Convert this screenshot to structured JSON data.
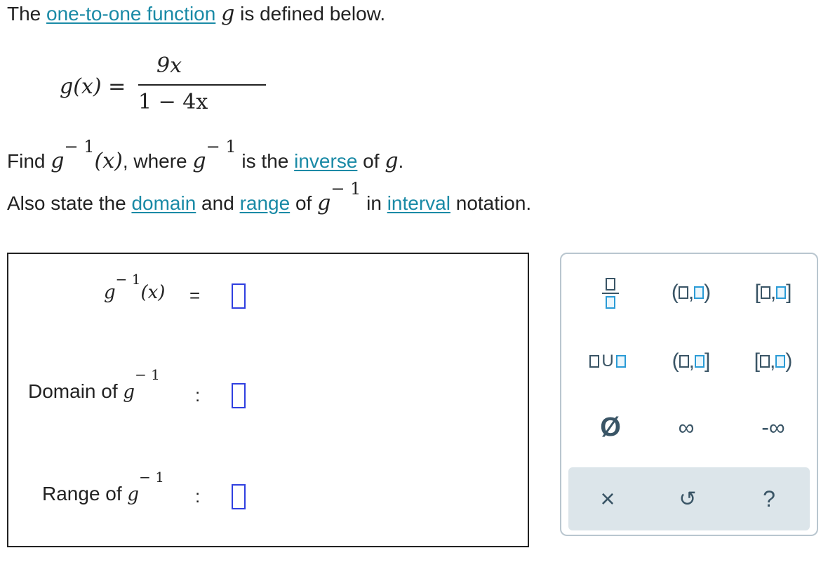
{
  "problem": {
    "line1": {
      "prefix": "The ",
      "link": "one-to-one function",
      "var": "g",
      "suffix": " is defined below."
    },
    "formula": {
      "lhs": "g(x) =",
      "numerator": "9x",
      "denominator": "1 − 4x"
    },
    "line2": {
      "find": "Find ",
      "g": "g",
      "sup": "− 1",
      "arg": "(x)",
      "where": ", where ",
      "is_the": " is the ",
      "link": "inverse",
      "of": " of ",
      "end": "."
    },
    "line3": {
      "prefix": "Also state the ",
      "domain_link": "domain",
      "and": " and ",
      "range_link": "range",
      "of": " of ",
      "g": "g",
      "sup": "− 1",
      "in": " in ",
      "interval_link": "interval",
      "suffix": " notation."
    }
  },
  "answer": {
    "inverse_label_g": "g",
    "inverse_label_sup": "− 1",
    "inverse_label_arg": "(x)",
    "equals": "=",
    "domain_label": "Domain of ",
    "range_label": "Range of ",
    "g": "g",
    "sup": "− 1",
    "colon": ":"
  },
  "keypad": {
    "open_open": [
      "(",
      ",",
      ")"
    ],
    "closed_closed": [
      "[",
      ",",
      "]"
    ],
    "open_closed": [
      "(",
      ",",
      "]"
    ],
    "closed_open": [
      "[",
      ",",
      ")"
    ],
    "union": "U",
    "empty_set": "Ø",
    "infinity": "∞",
    "neg_infinity": "-∞",
    "clear": "×",
    "undo": "↺",
    "help": "?"
  },
  "colors": {
    "link": "#1a8aa6",
    "placeholder": "#2f3fe0",
    "keypad_text": "#3a5566",
    "toolbar_bg": "#dce5ea"
  }
}
